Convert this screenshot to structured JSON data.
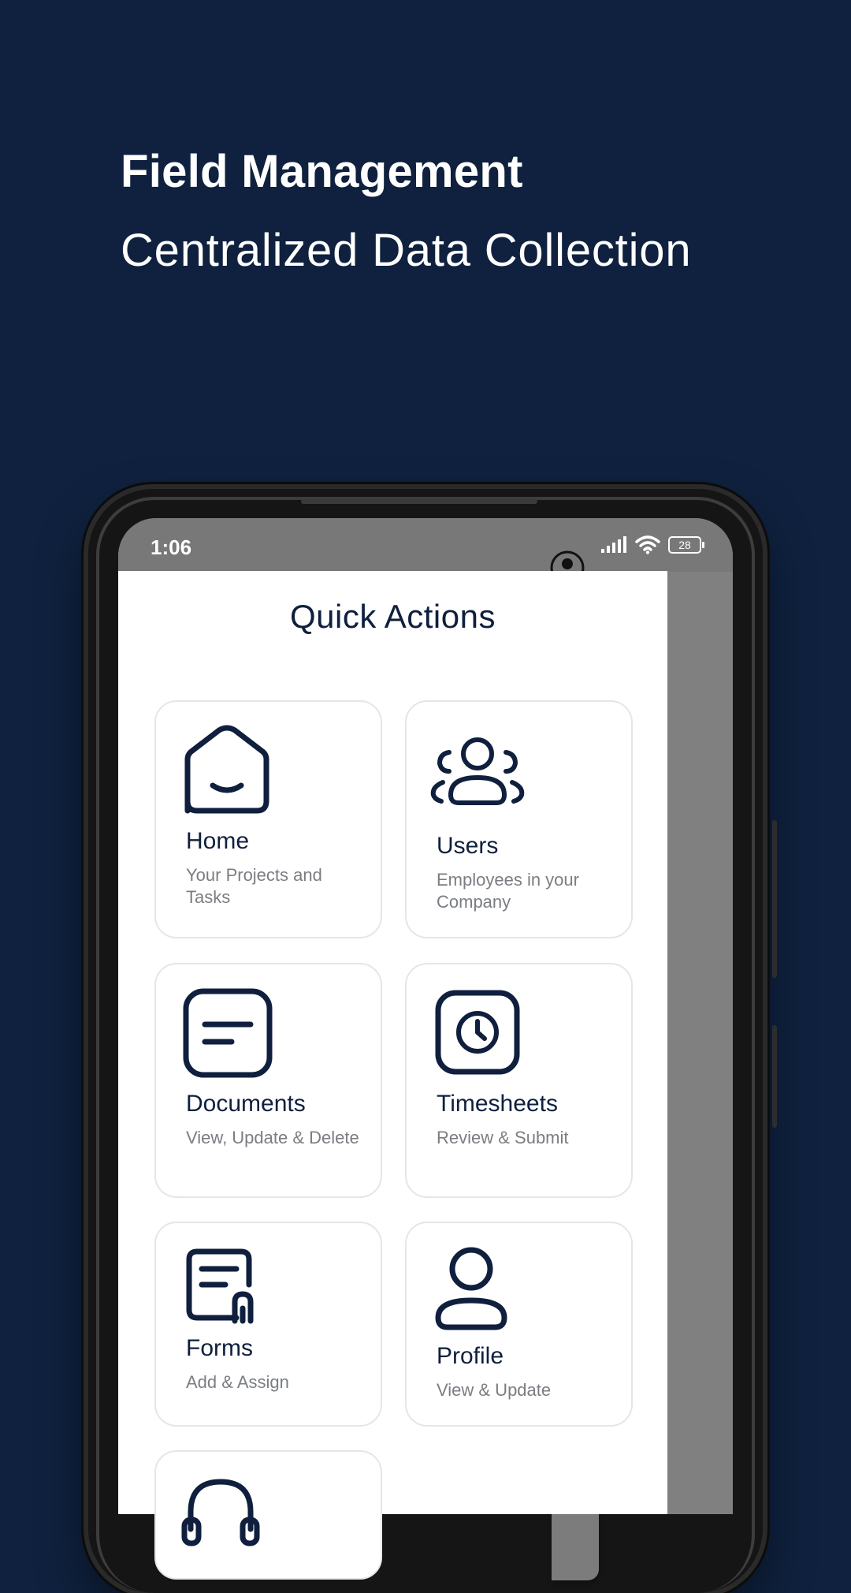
{
  "headline": {
    "title": "Field Management",
    "subtitle": "Centralized Data Collection"
  },
  "statusbar": {
    "time": "1:06",
    "battery": "28"
  },
  "drawer": {
    "title": "Quick Actions",
    "cards": [
      {
        "label": "Home",
        "sub": "Your Projects and Tasks",
        "icon": "home-icon"
      },
      {
        "label": "Users",
        "sub": "Employees in your Company",
        "icon": "users-icon"
      },
      {
        "label": "Documents",
        "sub": "View, Update & Delete",
        "icon": "document-icon"
      },
      {
        "label": "Timesheets",
        "sub": "Review & Submit",
        "icon": "clock-icon"
      },
      {
        "label": "Forms",
        "sub": "Add & Assign",
        "icon": "form-icon"
      },
      {
        "label": "Profile",
        "sub": "View & Update",
        "icon": "profile-icon"
      },
      {
        "label": "",
        "sub": "",
        "icon": "headset-icon"
      }
    ]
  },
  "colors": {
    "background": "#0f213e",
    "accent": "#0f1f3d",
    "card_border": "#e3e6ea"
  }
}
